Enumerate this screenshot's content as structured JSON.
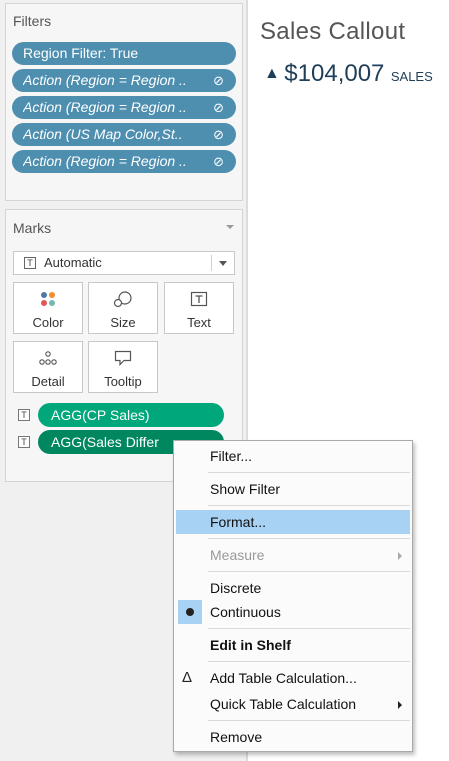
{
  "filters": {
    "title": "Filters",
    "pills": [
      {
        "label": "Region Filter: True",
        "italic": false,
        "linked": false
      },
      {
        "label": "Action (Region = Region ..",
        "italic": true,
        "linked": true
      },
      {
        "label": "Action (Region = Region ..",
        "italic": true,
        "linked": true
      },
      {
        "label": "Action (US Map Color,St..",
        "italic": true,
        "linked": true
      },
      {
        "label": "Action (Region = Region ..",
        "italic": true,
        "linked": true
      }
    ]
  },
  "marks": {
    "title": "Marks",
    "mark_type": "Automatic",
    "buttons": [
      {
        "label": "Color",
        "icon": "color-dots-icon"
      },
      {
        "label": "Size",
        "icon": "size-circles-icon"
      },
      {
        "label": "Text",
        "icon": "text-box-icon"
      },
      {
        "label": "Detail",
        "icon": "detail-dots-icon"
      },
      {
        "label": "Tooltip",
        "icon": "tooltip-bubble-icon"
      }
    ],
    "fields": [
      {
        "label": "AGG(CP Sales)"
      },
      {
        "label": "AGG(Sales Differ"
      }
    ],
    "colors": {
      "filter_pill": "#4e8fb0",
      "field_pill": "#00a77a",
      "field_pill_active": "#00875f"
    }
  },
  "view": {
    "title": "Sales Callout",
    "kpi_arrow": "▲",
    "kpi_value": "$104,007",
    "kpi_unit": "SALES"
  },
  "context_menu": {
    "items": [
      {
        "label": "Filter..."
      },
      {
        "label": "Show Filter"
      },
      {
        "label": "Format..."
      },
      {
        "label": "Measure"
      },
      {
        "label": "Discrete"
      },
      {
        "label": "Continuous"
      },
      {
        "label": "Edit in Shelf"
      },
      {
        "label": "Add Table Calculation..."
      },
      {
        "label": "Quick Table Calculation"
      },
      {
        "label": "Remove"
      }
    ],
    "highlight_color": "#a8d2f4"
  }
}
